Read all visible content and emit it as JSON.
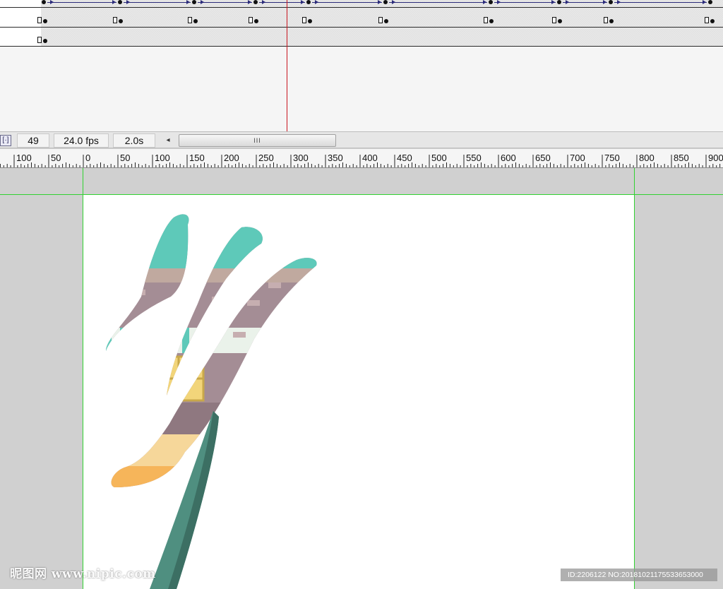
{
  "timeline": {
    "current_frame": "49",
    "frame_rate": "24.0 fps",
    "elapsed_time": "2.0s",
    "scrollbar_grip": "III",
    "scroll_left_arrow": "◂",
    "center_frame_icon": "[·]"
  },
  "ruler": {
    "labels": [
      "100",
      "50",
      "0",
      "50",
      "100",
      "150",
      "200",
      "250",
      "300",
      "350",
      "400",
      "450",
      "500",
      "550",
      "600",
      "650",
      "700",
      "750",
      "800",
      "850",
      "900"
    ]
  },
  "artwork": {
    "description_icon": "calligraphy-stroke-artwork",
    "colors": {
      "teal": "#5ec9b9",
      "mauve": "#a48d95",
      "cream": "#f2d57a",
      "orange": "#f6b55a",
      "pen": "#4f8f80"
    }
  },
  "guides": {
    "color": "#31d231"
  },
  "playhead": {
    "color": "#c8141e"
  },
  "watermark": {
    "left": "昵图网 www.nipic.com",
    "right": "ID:2206122 NO:20181021175533653000"
  }
}
